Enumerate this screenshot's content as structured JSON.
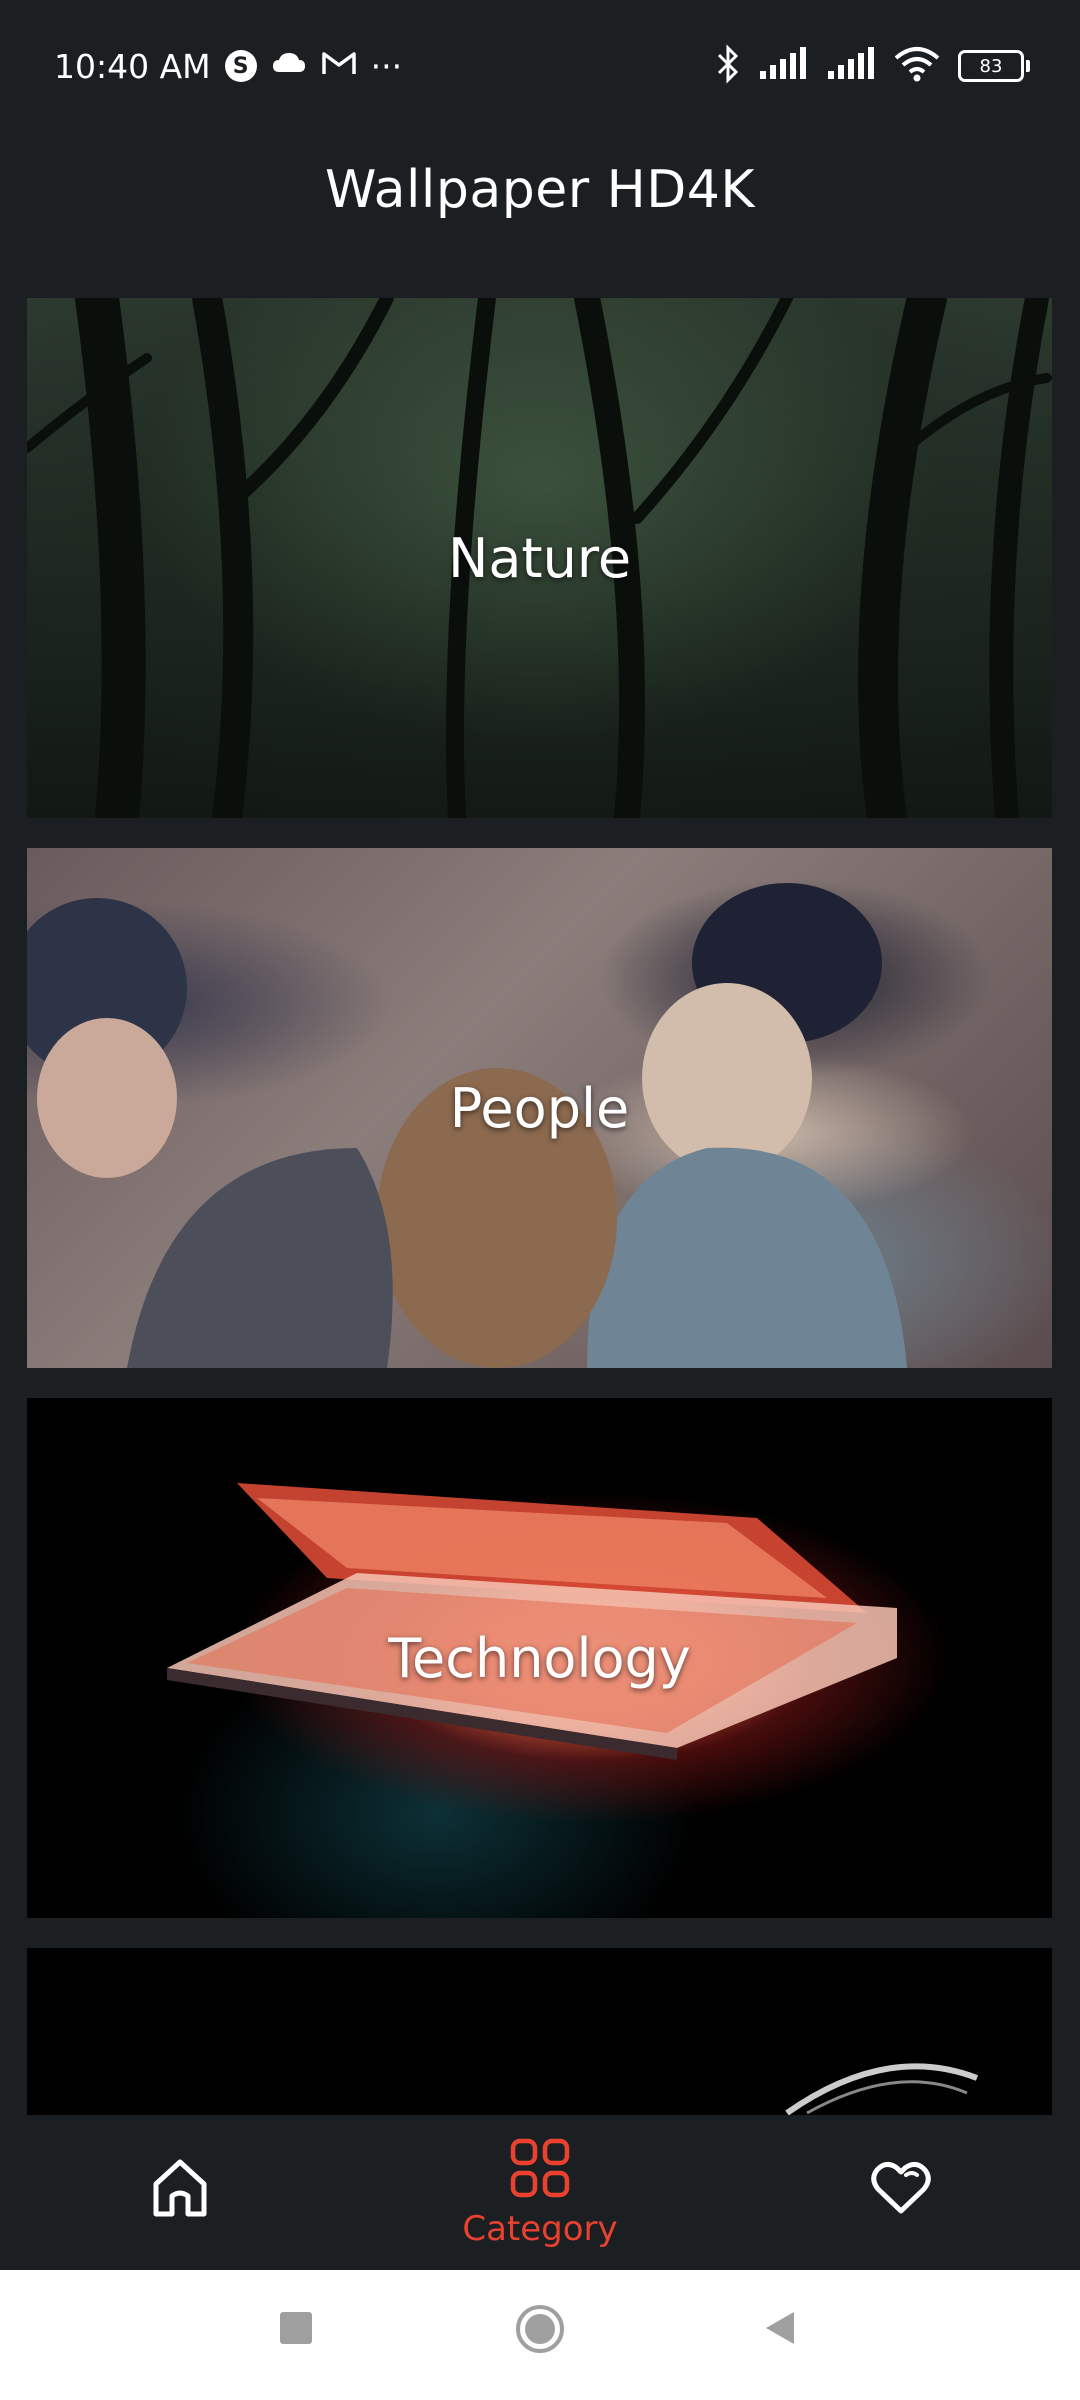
{
  "status_bar": {
    "time": "10:40 AM",
    "left_icons": [
      "skype-icon",
      "cloud-icon",
      "gmail-icon",
      "more-icon"
    ],
    "more_text": "···",
    "right_icons": [
      "bluetooth-icon",
      "signal-icon",
      "signal-icon",
      "wifi-icon",
      "battery-icon"
    ],
    "battery_level": "83"
  },
  "header": {
    "title": "Wallpaper HD4K"
  },
  "categories": [
    {
      "label": "Nature"
    },
    {
      "label": "People"
    },
    {
      "label": "Technology"
    },
    {
      "label": ""
    }
  ],
  "bottom_nav": {
    "items": [
      {
        "name": "home",
        "label": "",
        "icon": "home-icon",
        "active": false
      },
      {
        "name": "category",
        "label": "Category",
        "icon": "grid-icon",
        "active": true
      },
      {
        "name": "favorites",
        "label": "",
        "icon": "heart-icon",
        "active": false
      }
    ],
    "active_color": "#e8412f"
  },
  "system_nav": {
    "buttons": [
      "recents-button",
      "home-button",
      "back-button"
    ]
  }
}
